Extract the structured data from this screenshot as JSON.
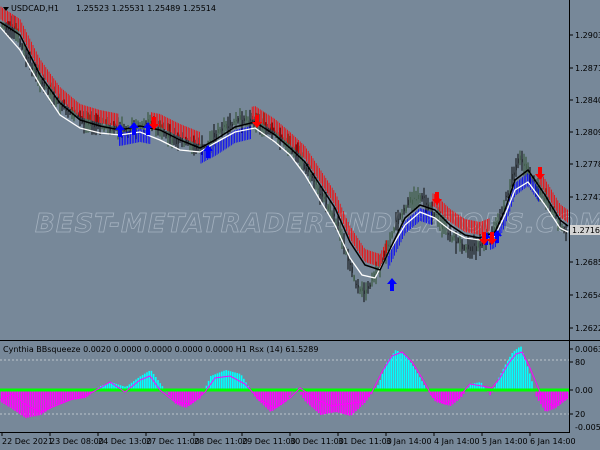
{
  "main_panel": {
    "header": {
      "symbol_timeframe": "USDCAD,H1",
      "ohlc": "1.25523 1.25531 1.25489 1.25514"
    },
    "watermark": "BEST-METATRADER-INDICATORS.COM",
    "price_axis": {
      "ticks": [
        "1.29030",
        "1.28715",
        "1.28405",
        "1.28095",
        "1.27780",
        "1.27470",
        "1.27160",
        "1.26850",
        "1.26540",
        "1.26225"
      ],
      "current_price": "1.27160"
    }
  },
  "sub_panel": {
    "indicator_label": "Cynthia BBsqueeze 0.0020 0.0000 0.0000 0.0000 0.0000  H1  Rsx (14) 61.5289",
    "axis": {
      "ticks": [
        "0.0063",
        "80",
        "0.00",
        "20",
        "-0.0058"
      ]
    }
  },
  "time_axis": {
    "labels": [
      "22 Dec 2021",
      "23 Dec 08:00",
      "24 Dec 13:00",
      "27 Dec 11:00",
      "28 Dec 11:00",
      "29 Dec 11:00",
      "30 Dec 11:00",
      "31 Dec 11:00",
      "3 Jan 14:00",
      "4 Jan 14:00",
      "5 Jan 14:00",
      "6 Jan 14:00"
    ]
  },
  "colors": {
    "background": "#778899",
    "bull_band": "#ff0000",
    "bear_band": "#0000ff",
    "arrow_up": "#0000ff",
    "arrow_down": "#ff0000",
    "slow_ma": "#000000",
    "fast_ma": "#ffffff",
    "histogram_up": "#00ffff",
    "histogram_down": "#ff00ff",
    "squeeze_dots": "#00ff00",
    "rsx_line": "#ff00ff"
  }
}
